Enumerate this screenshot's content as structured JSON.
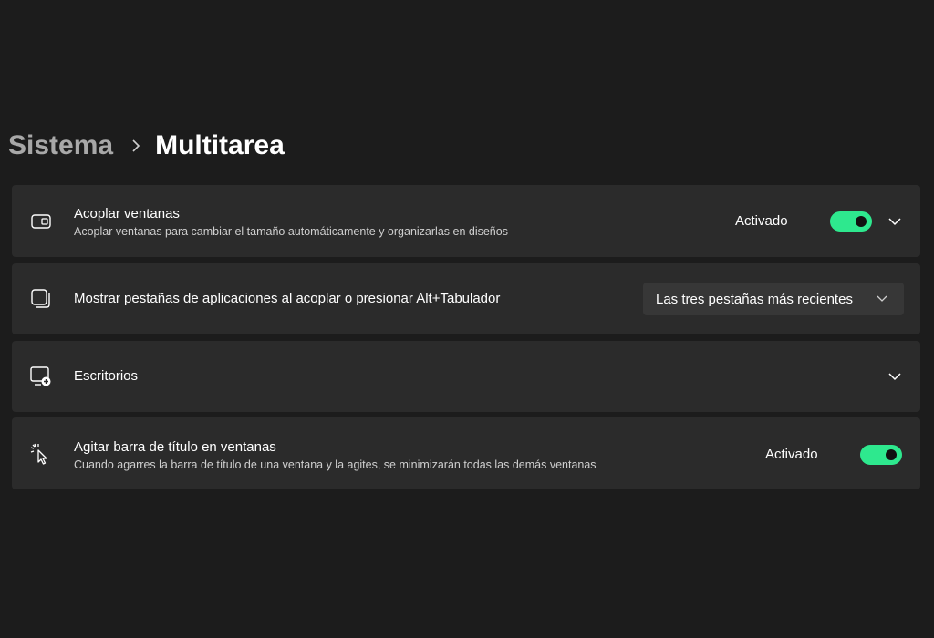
{
  "breadcrumb": {
    "parent": "Sistema",
    "current": "Multitarea",
    "separator_icon": "chevron-right-icon"
  },
  "settings": [
    {
      "icon": "snap-windows-icon",
      "title": "Acoplar ventanas",
      "description": "Acoplar ventanas para cambiar el tamaño automáticamente y organizarlas en diseños",
      "state_label": "Activado",
      "toggle_on": true,
      "expandable": true
    },
    {
      "icon": "app-tabs-icon",
      "title": "Mostrar pestañas de aplicaciones al acoplar o presionar Alt+Tabulador",
      "dropdown_value": "Las tres pestañas más recientes"
    },
    {
      "icon": "desktops-icon",
      "title": "Escritorios",
      "expandable": true
    },
    {
      "icon": "shake-cursor-icon",
      "title": "Agitar barra de título en ventanas",
      "description": "Cuando agarres la barra de título de una ventana y la agites, se minimizarán todas las demás ventanas",
      "state_label": "Activado",
      "toggle_on": true
    }
  ],
  "colors": {
    "background": "#1c1c1c",
    "card": "#2b2b2b",
    "accent": "#2ee88e",
    "dropdown": "#373737"
  }
}
